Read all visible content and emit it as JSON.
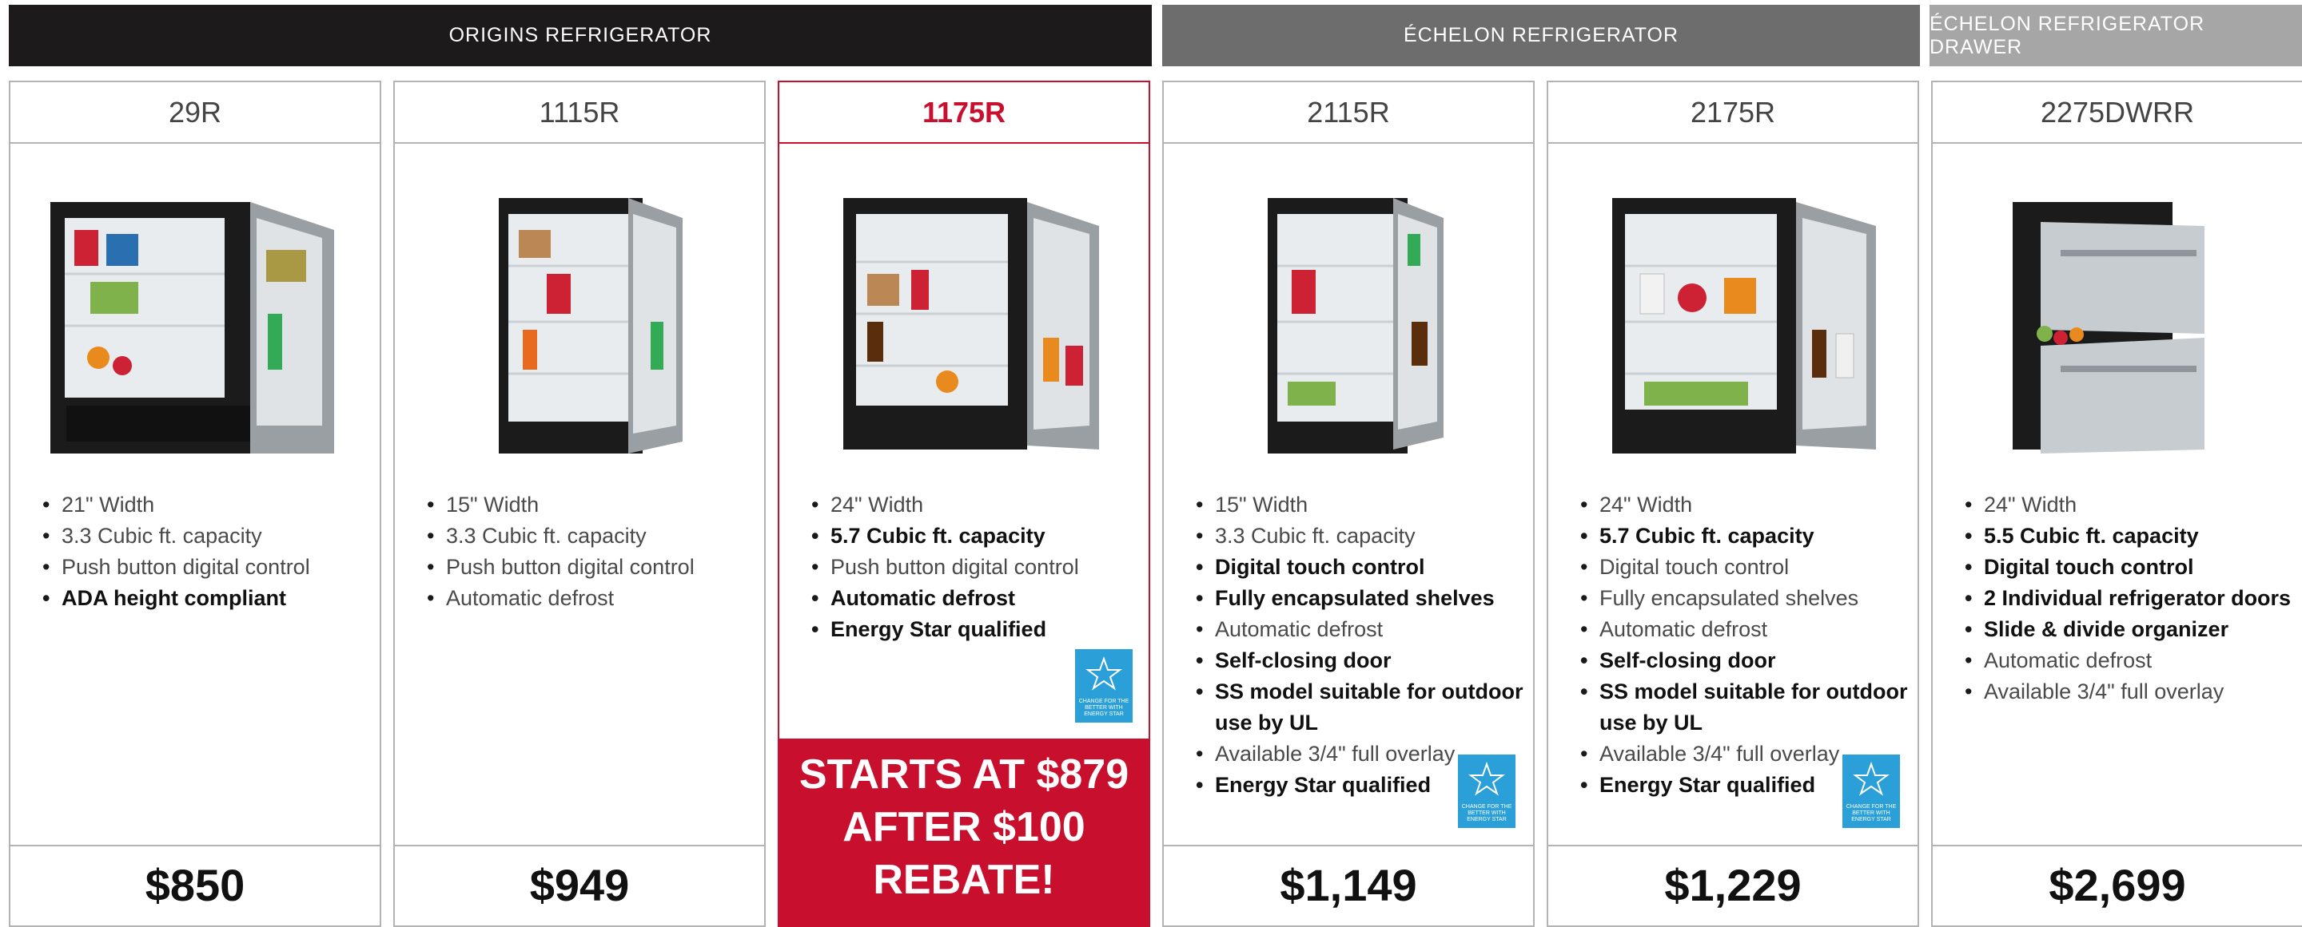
{
  "sections": [
    {
      "title": "ORIGINS REFRIGERATOR"
    },
    {
      "title": "ÉCHELON REFRIGERATOR"
    },
    {
      "title": "ÉCHELON REFRIGERATOR DRAWER"
    }
  ],
  "products": [
    {
      "model": "29R",
      "features": [
        {
          "text": "21\" Width",
          "bold": false
        },
        {
          "text": "3.3 Cubic ft. capacity",
          "bold": false
        },
        {
          "text": "Push button digital control",
          "bold": false
        },
        {
          "text": "ADA height compliant",
          "bold": true
        }
      ],
      "price": "$850"
    },
    {
      "model": "1115R",
      "features": [
        {
          "text": "15\" Width",
          "bold": false
        },
        {
          "text": "3.3 Cubic ft. capacity",
          "bold": false
        },
        {
          "text": "Push button digital control",
          "bold": false
        },
        {
          "text": "Automatic defrost",
          "bold": false
        }
      ],
      "price": "$949"
    },
    {
      "model": "1175R",
      "features": [
        {
          "text": "24\" Width",
          "bold": false
        },
        {
          "text": "5.7 Cubic ft. capacity",
          "bold": true
        },
        {
          "text": "Push button digital control",
          "bold": false
        },
        {
          "text": "Automatic defrost",
          "bold": true
        },
        {
          "text": "Energy Star qualified",
          "bold": true
        }
      ],
      "promo": "STARTS AT $879 AFTER $100 REBATE!"
    },
    {
      "model": "2115R",
      "features": [
        {
          "text": "15\" Width",
          "bold": false
        },
        {
          "text": "3.3 Cubic ft. capacity",
          "bold": false
        },
        {
          "text": "Digital touch control",
          "bold": true
        },
        {
          "text": "Fully encapsulated shelves",
          "bold": true
        },
        {
          "text": "Automatic defrost",
          "bold": false
        },
        {
          "text": "Self-closing door",
          "bold": true
        },
        {
          "text": "SS model suitable for outdoor use by UL",
          "bold": true
        },
        {
          "text": "Available 3/4\" full overlay",
          "bold": false
        },
        {
          "text": "Energy Star qualified",
          "bold": true
        }
      ],
      "price": "$1,149"
    },
    {
      "model": "2175R",
      "features": [
        {
          "text": "24\" Width",
          "bold": false
        },
        {
          "text": "5.7 Cubic ft. capacity",
          "bold": true
        },
        {
          "text": "Digital touch control",
          "bold": false
        },
        {
          "text": "Fully encapsulated shelves",
          "bold": false
        },
        {
          "text": "Automatic defrost",
          "bold": false
        },
        {
          "text": "Self-closing door",
          "bold": true
        },
        {
          "text": "SS model suitable for outdoor use by UL",
          "bold": true
        },
        {
          "text": "Available 3/4\" full overlay",
          "bold": false
        },
        {
          "text": "Energy Star qualified",
          "bold": true
        }
      ],
      "price": "$1,229"
    },
    {
      "model": "2275DWRR",
      "features": [
        {
          "text": "24\" Width",
          "bold": false
        },
        {
          "text": "5.5 Cubic ft. capacity",
          "bold": true
        },
        {
          "text": "Digital touch control",
          "bold": true
        },
        {
          "text": "2 Individual refrigerator doors",
          "bold": true
        },
        {
          "text": "Slide & divide organizer",
          "bold": true
        },
        {
          "text": "Automatic defrost",
          "bold": false
        },
        {
          "text": "Available 3/4\" full overlay",
          "bold": false
        }
      ],
      "price": "$2,699"
    }
  ],
  "energy_star_badge": {
    "icon": "energy-star-icon",
    "text": "CHANGE FOR THE BETTER WITH ENERGY STAR"
  },
  "colors": {
    "origins_header": "#1c1a1a",
    "echelon_header": "#6d6d6d",
    "drawer_header": "#a6a6a6",
    "accent_red": "#c8102e",
    "energy_blue": "#2a9fd8"
  }
}
